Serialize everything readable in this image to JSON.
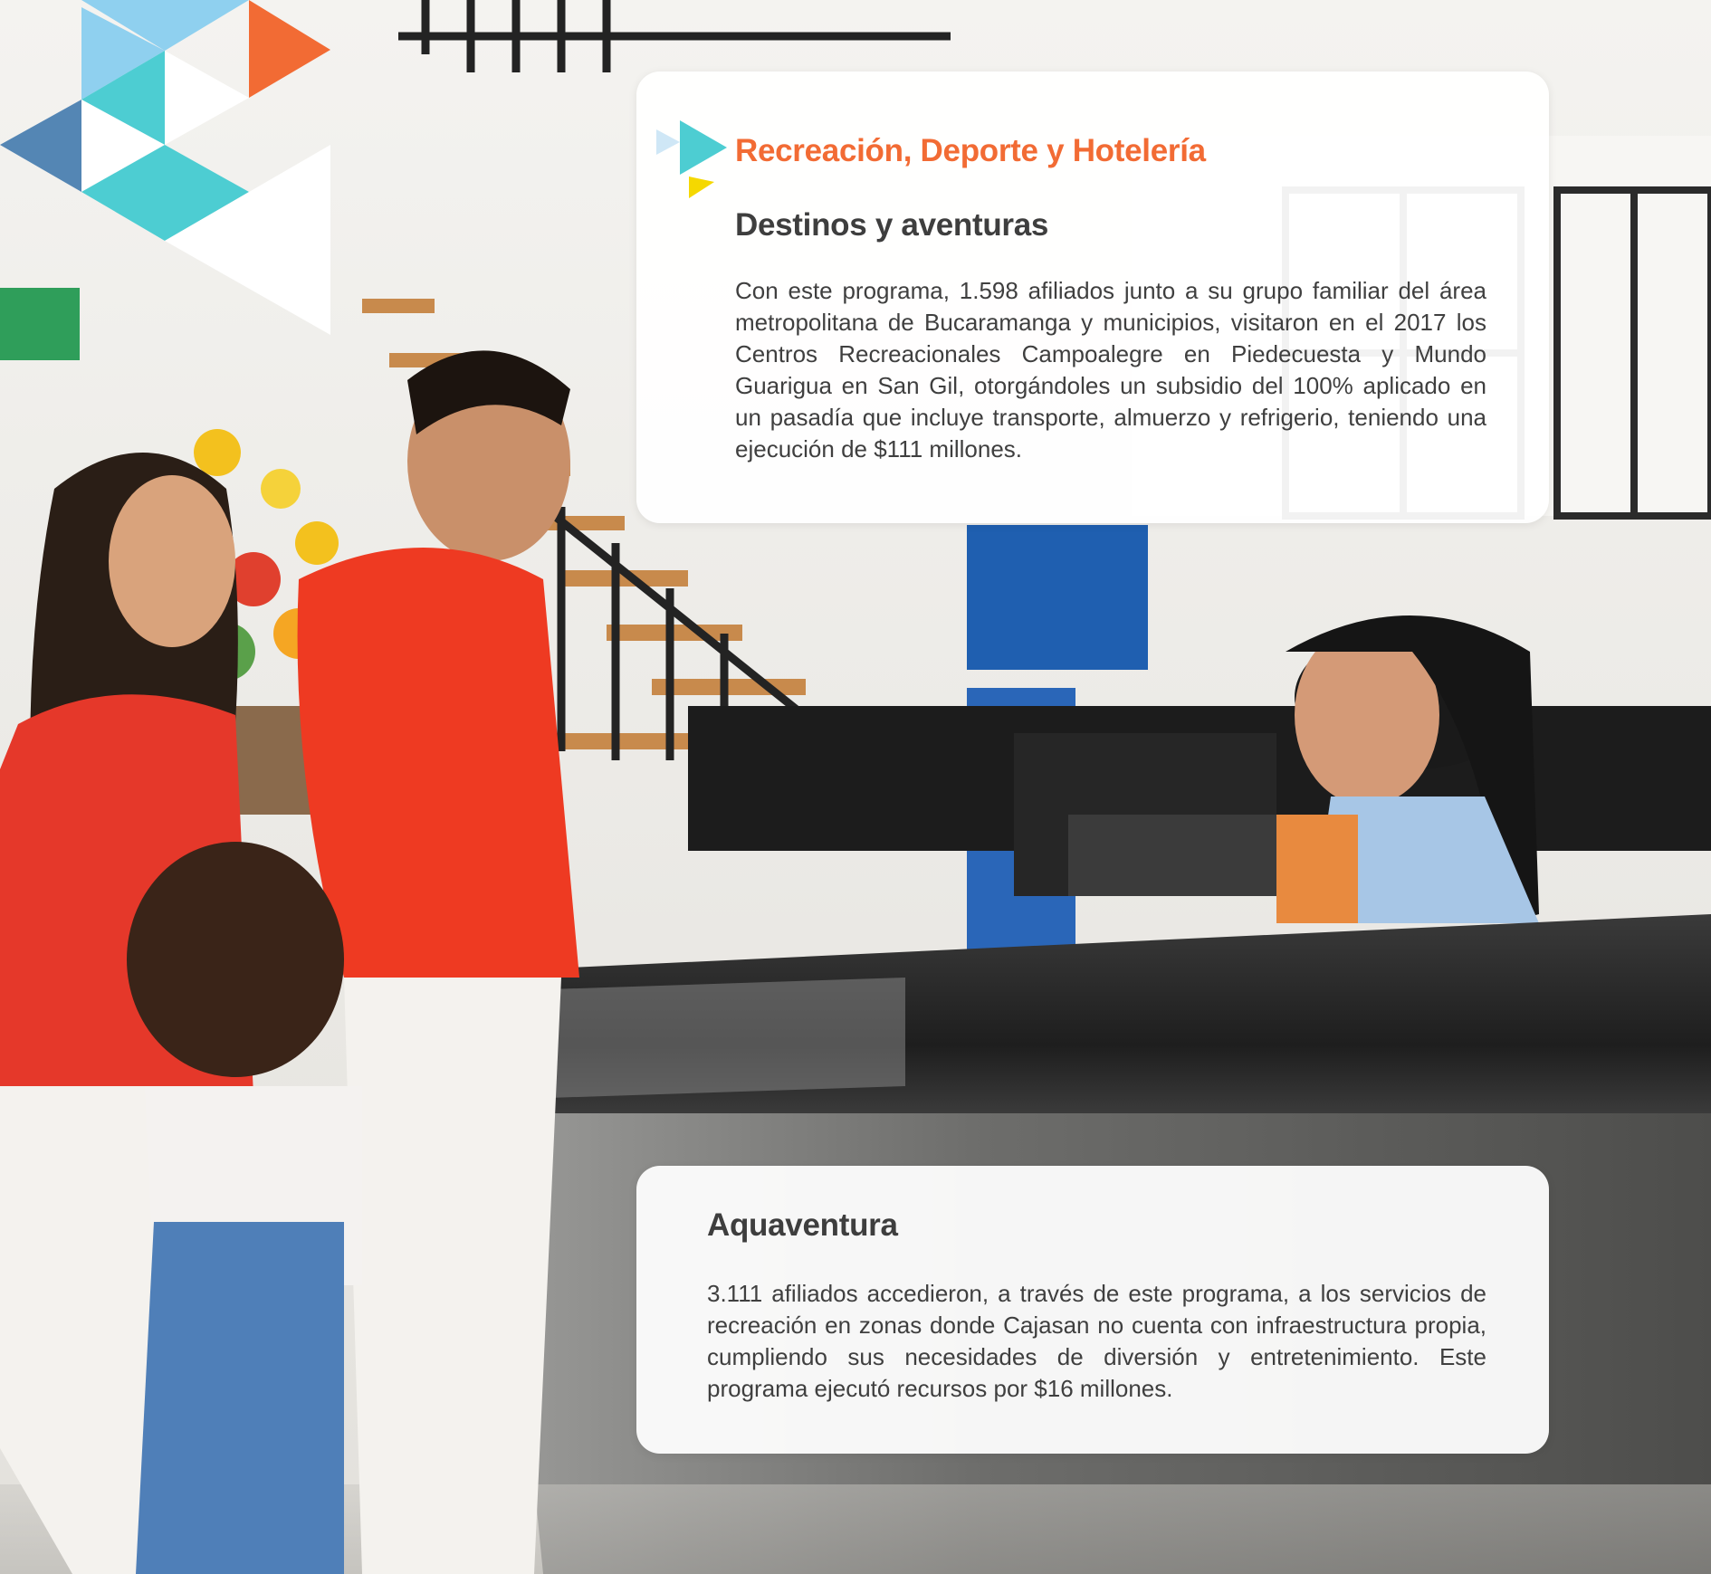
{
  "section": {
    "title": "Recreación, Deporte y Hotelería",
    "accent_color": "#f26b34"
  },
  "cards": [
    {
      "heading": "Destinos y aventuras",
      "body": "Con este programa, 1.598 afiliados junto a su grupo familiar del área metropolitana de Bucaramanga y municipios, visitaron en el 2017 los Centros Recreacionales Campoalegre en Piedecuesta y Mundo Guarigua en San Gil, otorgándoles un subsidio del 100% aplicado en un pasadía que incluye transporte, almuerzo y refrigerio, teniendo una ejecución de $111 millones."
    },
    {
      "heading": "Aquaventura",
      "body": "3.111 afiliados accedieron, a través de este programa, a los servicios de recreación en zonas donde Cajasan no cuenta con infraestructura propia, cumpliendo sus necesidades de diversión y entretenimiento. Este programa ejecutó recursos por $16 millones."
    }
  ],
  "decoration": {
    "palette": [
      "#8fd0ef",
      "#4dcdd2",
      "#f26b34",
      "#5486b4",
      "#f5d800",
      "#ffffff"
    ],
    "icon": "triangle-pattern-icon"
  },
  "photo": {
    "icon": "family-at-reception-photo"
  }
}
